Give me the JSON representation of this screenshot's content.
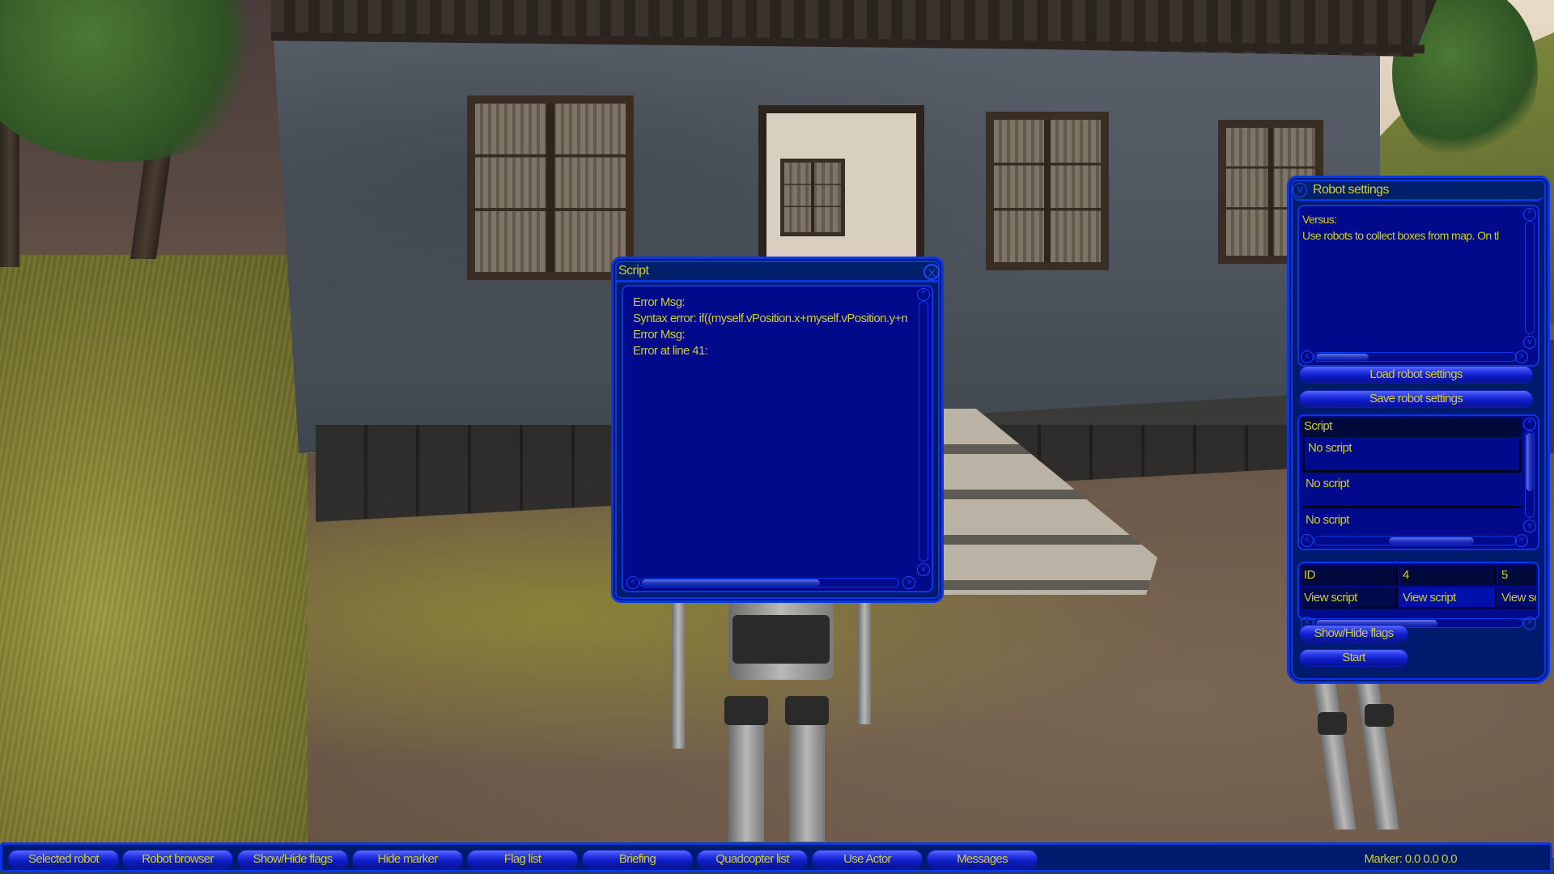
{
  "script_window": {
    "title": "Script",
    "close_label": "X",
    "lines": [
      "Error Msg:",
      "Syntax error: if((myself.vPosition.x+myself.vPosition.y+m",
      "Error Msg:",
      "Error at line 41:"
    ],
    "scroll_up_label": "^",
    "scroll_down_label": "v",
    "scroll_left_label": "<",
    "scroll_right_label": ">"
  },
  "robot_settings": {
    "title": "Robot settings",
    "collapse_label": "V",
    "description_lines": [
      "Versus:",
      "Use robots to collect boxes from map. On tl"
    ],
    "load_button": "Load robot settings",
    "save_button": "Save robot settings",
    "script_list": {
      "header": "Script",
      "rows": [
        "No script",
        "No script",
        "No script"
      ]
    },
    "robot_grid": {
      "header_row": [
        "ID",
        "4",
        "5"
      ],
      "action_row": [
        "View script",
        "View script",
        "View sc"
      ]
    },
    "show_hide_flags_button": "Show/Hide flags",
    "start_button": "Start",
    "scroll_up_label": "^",
    "scroll_down_label": "v",
    "scroll_left_label": "<",
    "scroll_right_label": ">"
  },
  "toolbar": {
    "buttons": [
      "Selected robot",
      "Robot browser",
      "Show/Hide flags",
      "Hide marker",
      "Flag list",
      "Briefing",
      "Quadcopter list",
      "Use Actor",
      "Messages"
    ],
    "marker_readout": "Marker: 0.0 0.0 0.0"
  },
  "theme": {
    "panel_bg": "#001a6e",
    "panel_border": "#0a36e6",
    "text_area_bg": "#000a8a",
    "text_color": "#d0cc2a"
  }
}
